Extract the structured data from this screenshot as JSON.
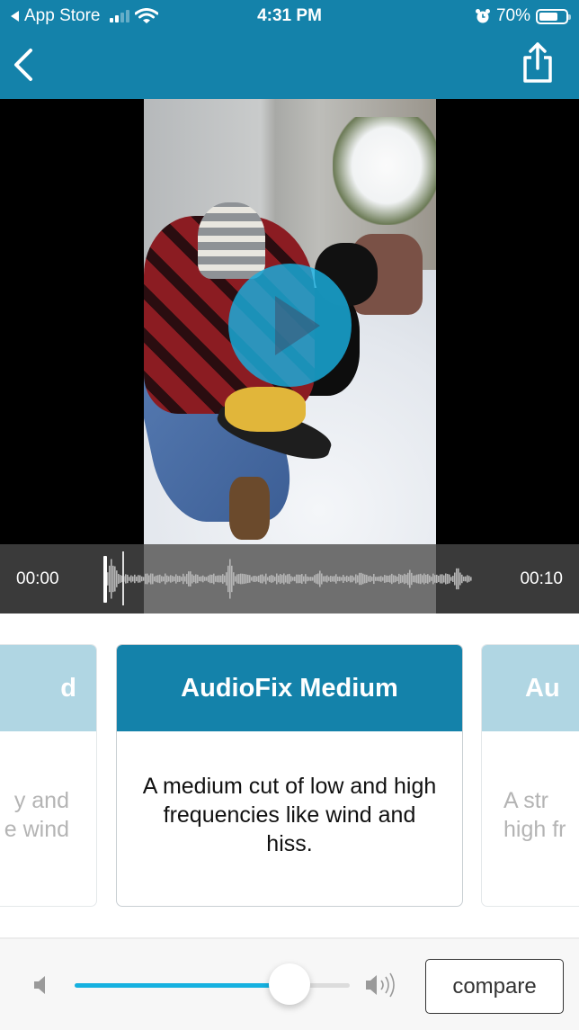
{
  "status_bar": {
    "back_app": "App Store",
    "time": "4:31 PM",
    "battery_percent": "70%",
    "battery_level": 0.7,
    "signal_bars_active": 2,
    "signal_bars_total": 4,
    "icons": [
      "back-to-app-icon",
      "cellular-signal-icon",
      "wifi-icon",
      "alarm-icon",
      "battery-icon"
    ]
  },
  "nav": {
    "back_icon": "chevron-left-icon",
    "share_icon": "share-icon"
  },
  "colors": {
    "brand": "#1482aa",
    "brand_light": "#b0d6e3",
    "play_button": "#19afde",
    "slider_fill": "#16b1e0"
  },
  "video": {
    "play_icon": "play-icon",
    "start_time": "00:00",
    "end_time": "00:10",
    "playhead_fraction": 0.0
  },
  "presets": [
    {
      "title": "AudioFix Mild",
      "title_visible": "d",
      "description_visible": "y and\ne wind",
      "active": false
    },
    {
      "title": "AudioFix Medium",
      "description": "A medium cut of low and high frequencies like wind and hiss.",
      "active": true
    },
    {
      "title_visible": "Au",
      "description_visible": "A str\nhigh fr",
      "active": false
    }
  ],
  "controls": {
    "volume_low_icon": "speaker-low-icon",
    "volume_high_icon": "speaker-high-icon",
    "mix_slider_value": 0.78,
    "compare_label": "compare"
  }
}
